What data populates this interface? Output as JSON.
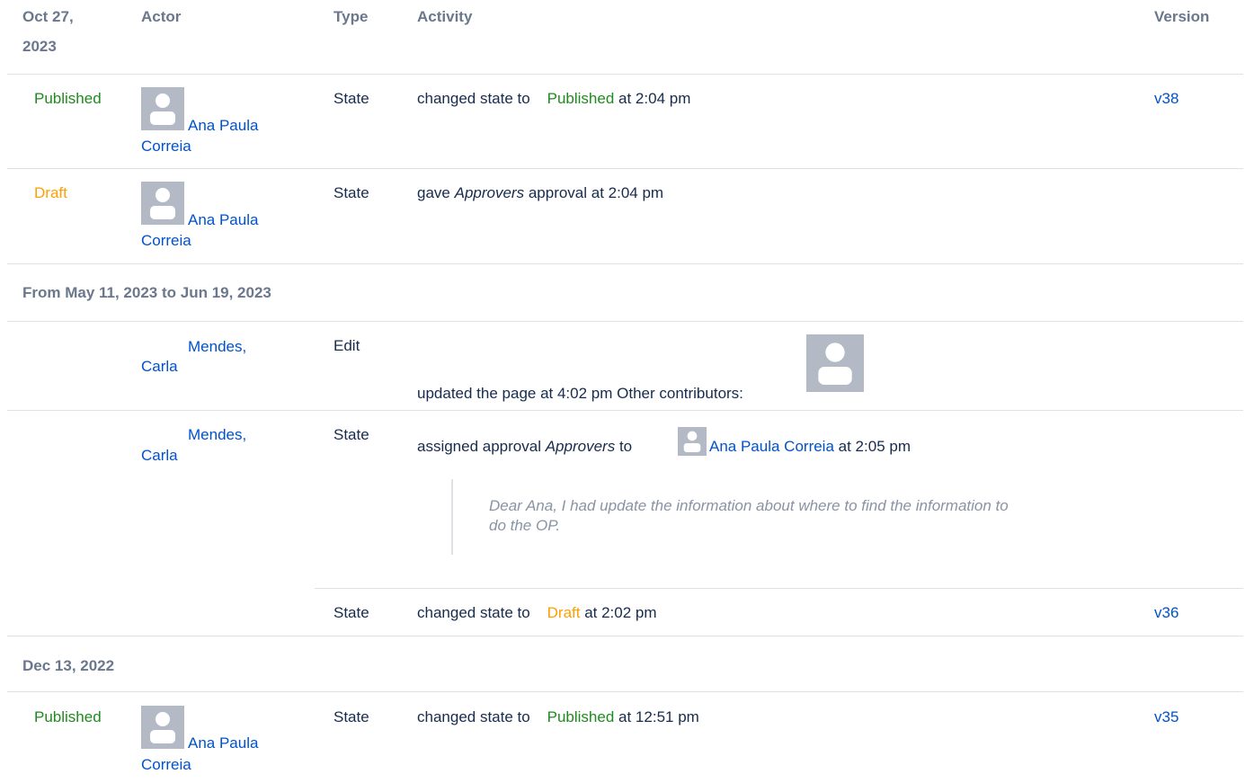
{
  "columns": {
    "date": "Oct 27,",
    "date_year": "2023",
    "actor": "Actor",
    "type": "Type",
    "activity": "Activity",
    "version": "Version"
  },
  "rows": [
    {
      "status": "Published",
      "actor_line1": "Ana Paula",
      "actor_line2": "Correia",
      "type": "State",
      "activity_prefix": "changed state to",
      "activity_state": "Published",
      "activity_suffix": "at 2:04 pm",
      "version": "v38"
    },
    {
      "status": "Draft",
      "actor_line1": "Ana Paula",
      "actor_line2": "Correia",
      "type": "State",
      "activity_pre": "gave",
      "activity_italic": "Approvers",
      "activity_post": "approval at 2:04 pm"
    }
  ],
  "group2": {
    "title": "From May 11, 2023 to Jun 19, 2023",
    "edit_row": {
      "actor_line1": "Mendes,",
      "actor_line2": "Carla",
      "type": "Edit",
      "activity": "updated the page at 4:02 pm Other contributors:"
    },
    "assign_row": {
      "actor_line1": "Mendes,",
      "actor_line2": "Carla",
      "type": "State",
      "activity_pre": "assigned approval",
      "activity_italic": "Approvers",
      "activity_to": "to",
      "assignee": "Ana Paula Correia",
      "activity_post": "at 2:05 pm",
      "comment": "Dear Ana, I had update the information about where to find the information to do the OP."
    },
    "draft_row": {
      "type": "State",
      "activity_prefix": "changed state to",
      "activity_state": "Draft",
      "activity_suffix": "at 2:02 pm",
      "version": "v36"
    }
  },
  "group3": {
    "title": "Dec 13, 2022",
    "row": {
      "status": "Published",
      "actor_line1": "Ana Paula",
      "actor_line2": "Correia",
      "type": "State",
      "activity_prefix": "changed state to",
      "activity_state": "Published",
      "activity_suffix": "at 12:51 pm",
      "version": "v35"
    }
  },
  "colors": {
    "published": "#1f8a1f",
    "draft": "#ff9f00",
    "link": "#0052cc",
    "header": "#6b778c",
    "avatar": "#b3bac5"
  },
  "icons": {
    "avatar": "default-user-avatar-icon"
  }
}
